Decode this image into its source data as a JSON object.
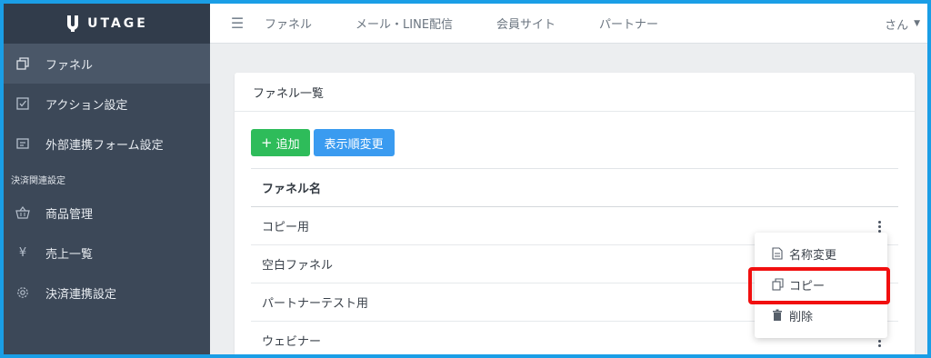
{
  "brand": {
    "name": "UTAGE"
  },
  "sidebar": {
    "items": [
      {
        "label": "ファネル",
        "icon": "copy-icon",
        "active": true
      },
      {
        "label": "アクション設定",
        "icon": "checkbox-icon",
        "active": false
      },
      {
        "label": "外部連携フォーム設定",
        "icon": "form-icon",
        "active": false
      }
    ],
    "section_label": "決済関連設定",
    "payment_items": [
      {
        "label": "商品管理",
        "icon": "basket-icon"
      },
      {
        "label": "売上一覧",
        "icon": "yen-icon"
      },
      {
        "label": "決済連携設定",
        "icon": "gear-icon"
      }
    ]
  },
  "topbar": {
    "nav": [
      "ファネル",
      "メール・LINE配信",
      "会員サイト",
      "パートナー"
    ],
    "user_label": "さん"
  },
  "card": {
    "title": "ファネル一覧",
    "add_button": "追加",
    "order_button": "表示順変更",
    "column_header": "ファネル名",
    "rows": [
      "コピー用",
      "空白ファネル",
      "パートナーテスト用",
      "ウェビナー"
    ]
  },
  "dropdown": {
    "items": [
      {
        "label": "名称変更",
        "icon": "document-icon"
      },
      {
        "label": "コピー",
        "icon": "copy-icon"
      },
      {
        "label": "削除",
        "icon": "trash-icon"
      }
    ]
  },
  "colors": {
    "sidebar_bg": "#3c4858",
    "add_button": "#2ebc5a",
    "order_button": "#3a9bf0",
    "highlight": "#f10f0f",
    "frame": "#1a9ee6"
  }
}
